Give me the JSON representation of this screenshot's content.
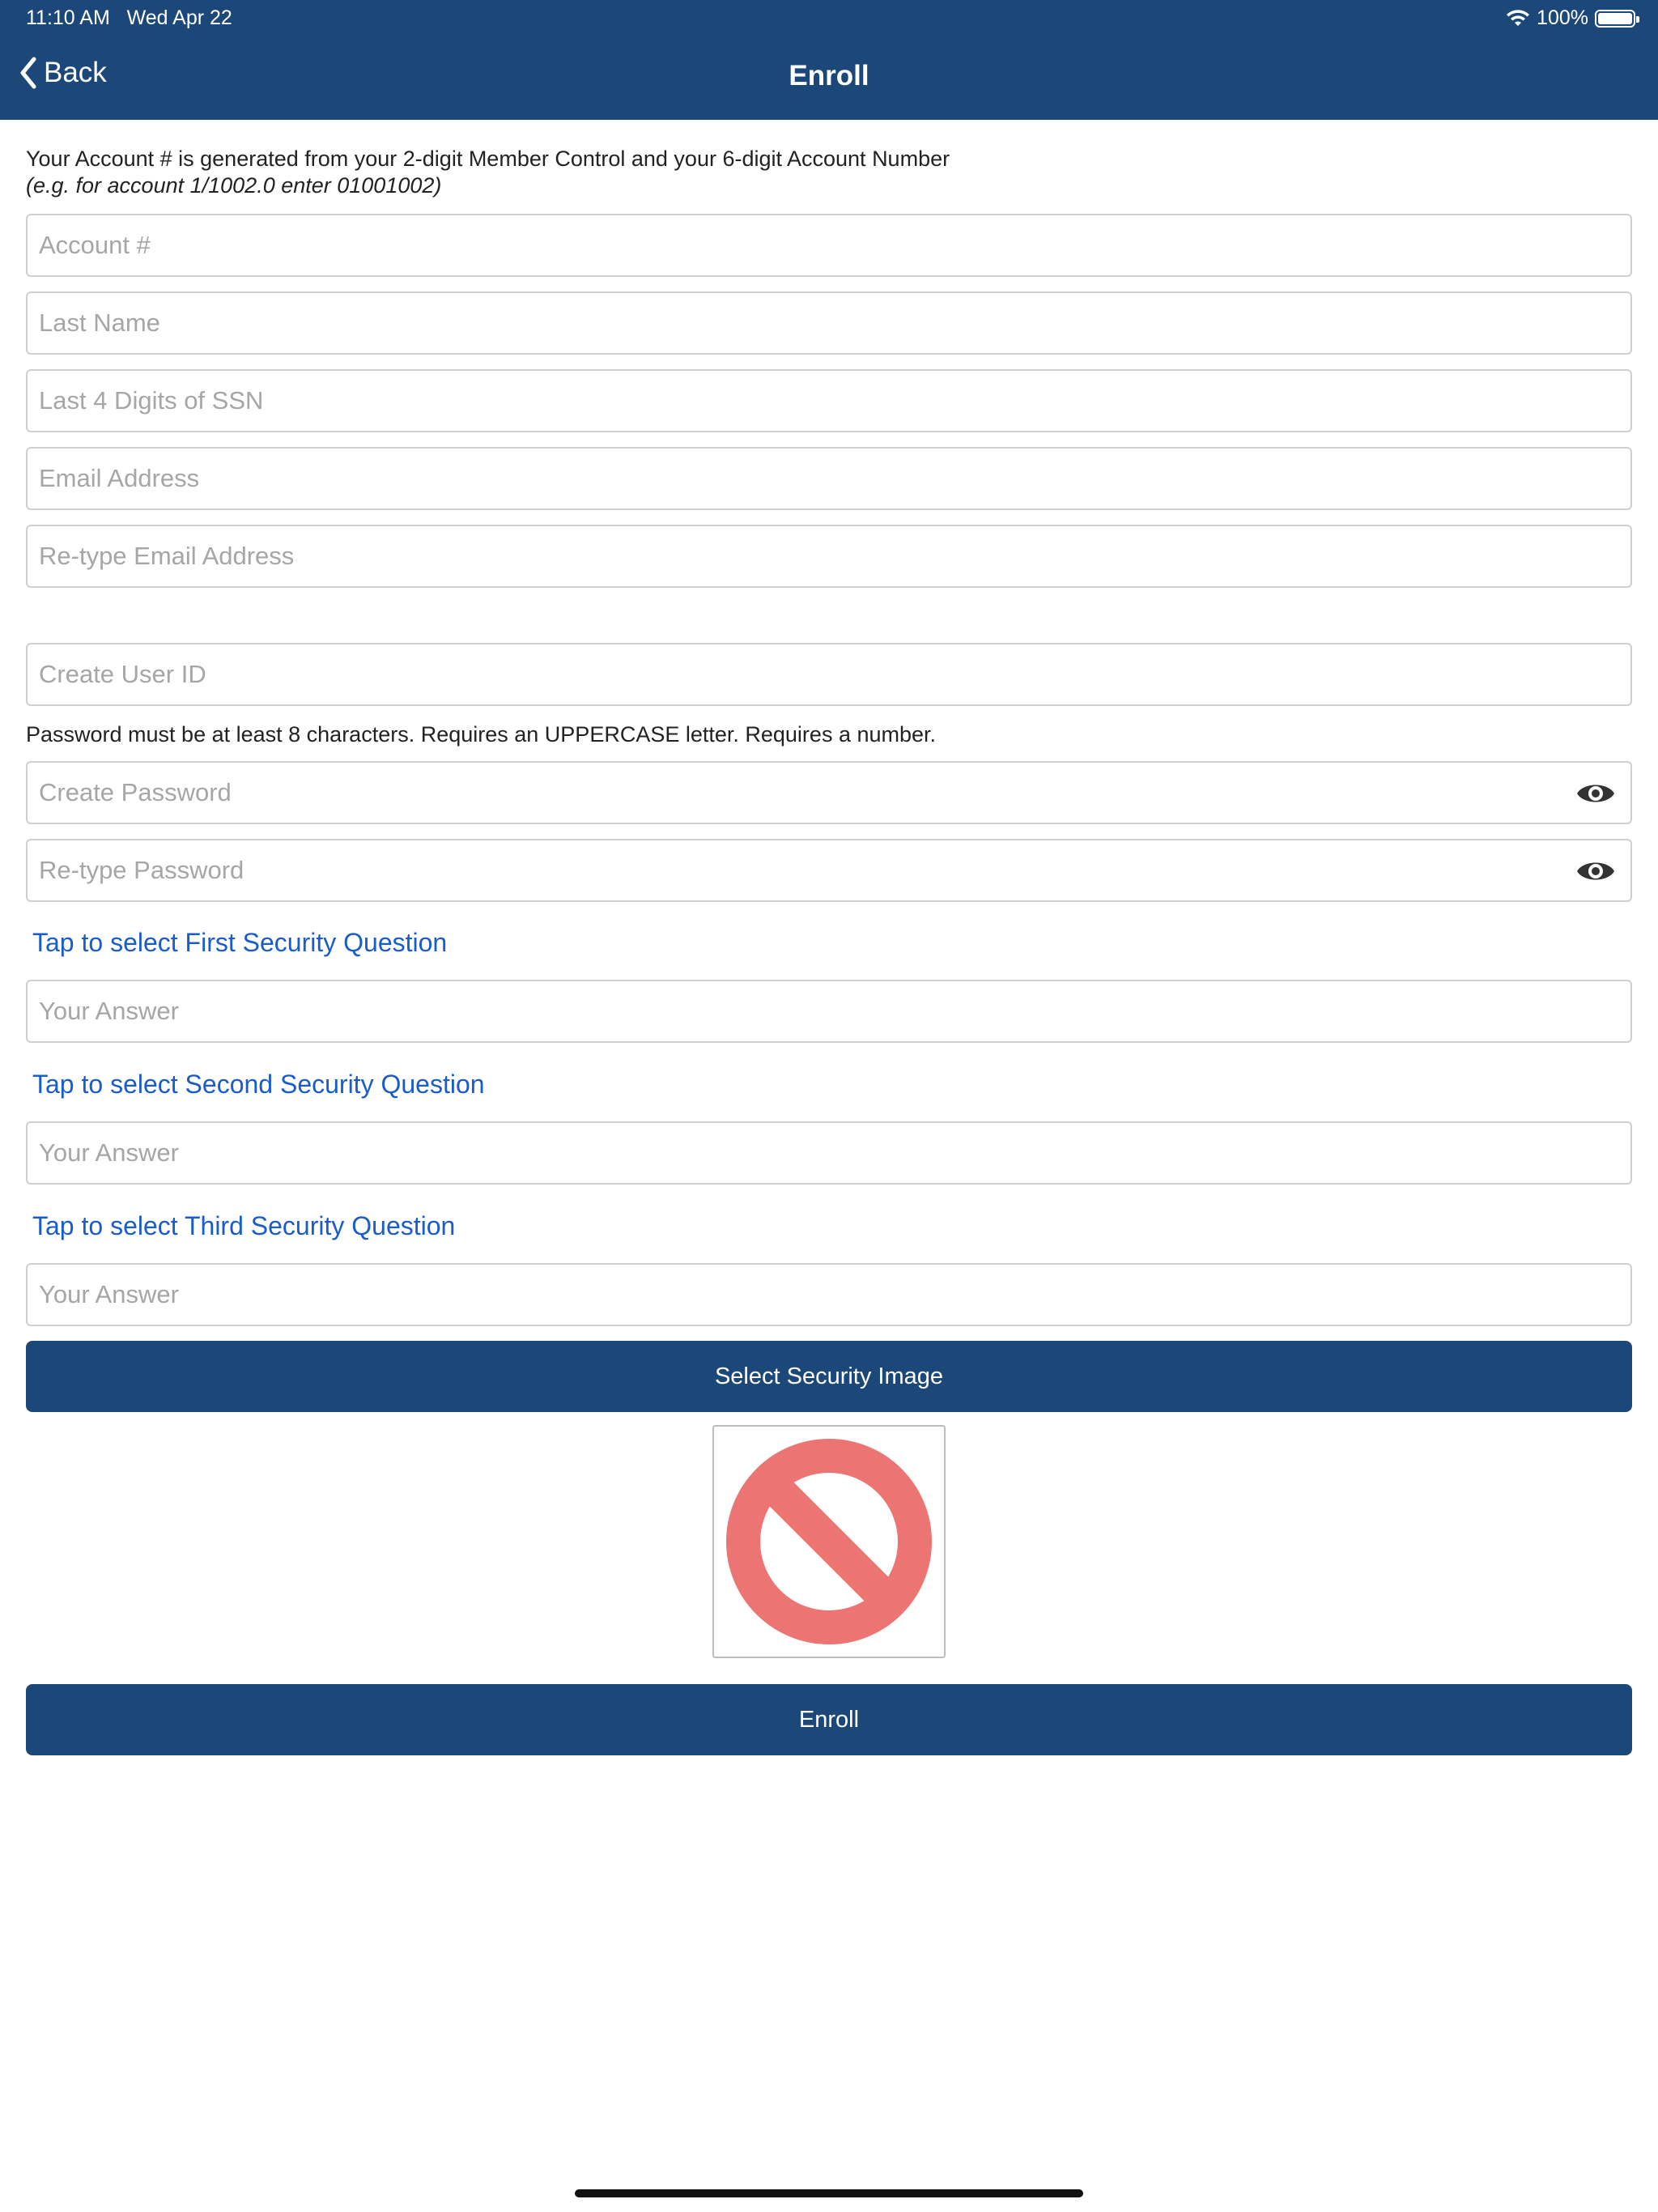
{
  "status": {
    "time": "11:10 AM",
    "date": "Wed Apr 22",
    "battery": "100%"
  },
  "nav": {
    "back_label": "Back",
    "title": "Enroll"
  },
  "info": {
    "line1": "Your Account # is generated from your 2-digit Member Control and your 6-digit Account Number",
    "line2": "(e.g. for account 1/1002.0 enter 01001002)"
  },
  "fields": {
    "account": "Account #",
    "last_name": "Last Name",
    "ssn": "Last 4 Digits of SSN",
    "email": "Email Address",
    "email_retype": "Re-type Email Address",
    "user_id": "Create User ID",
    "password": "Create Password",
    "password_retype": "Re-type Password",
    "answer": "Your Answer"
  },
  "password_note": "Password must be at least 8 characters. Requires an UPPERCASE letter. Requires a number.",
  "security": {
    "q1": "Tap to select First Security Question",
    "q2": "Tap to select Second Security Question",
    "q3": "Tap to select Third Security Question"
  },
  "buttons": {
    "select_image": "Select Security Image",
    "enroll": "Enroll"
  },
  "colors": {
    "brand": "#1b4878",
    "link": "#1a5cc8",
    "prohibited": "#ec7472"
  }
}
